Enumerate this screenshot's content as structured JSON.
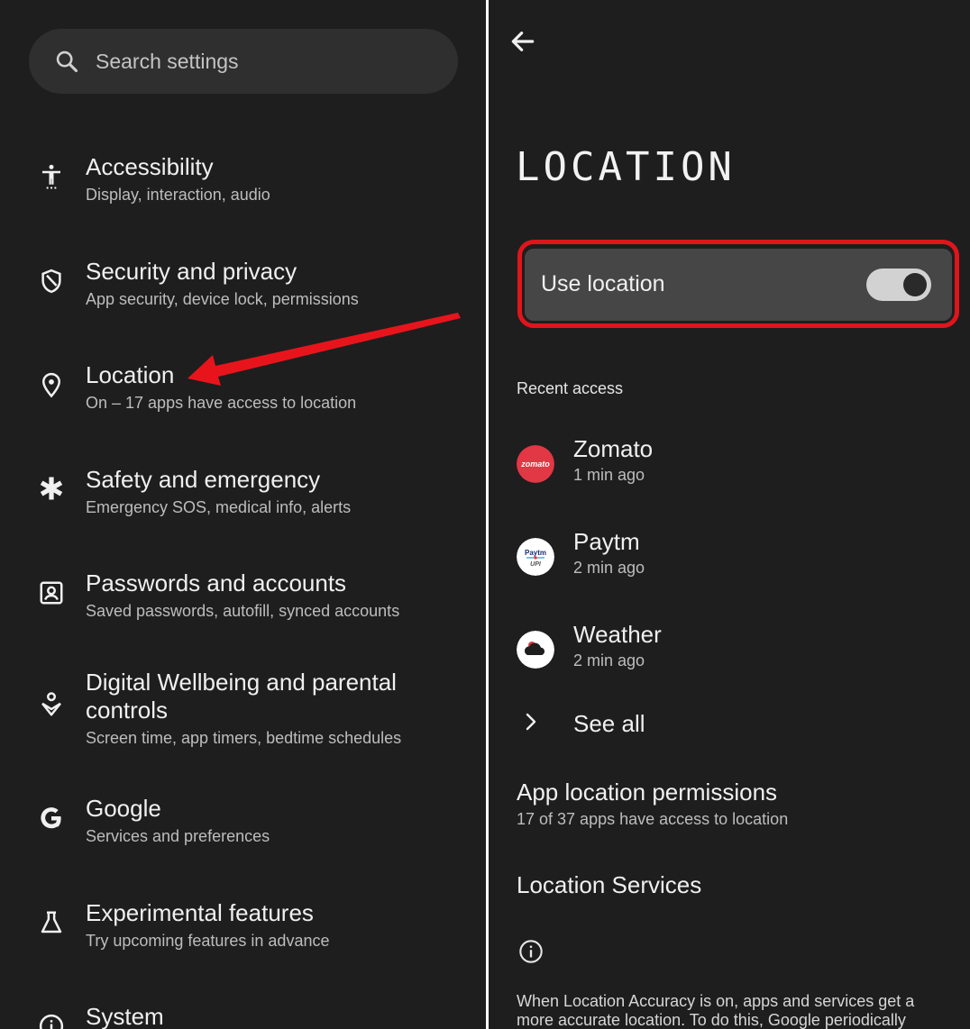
{
  "search": {
    "placeholder": "Search settings"
  },
  "settings": [
    {
      "title": "Accessibility",
      "subtitle": "Display, interaction, audio",
      "icon": "accessibility-icon"
    },
    {
      "title": "Security and privacy",
      "subtitle": "App security, device lock, permissions",
      "icon": "shield-icon"
    },
    {
      "title": "Location",
      "subtitle": "On – 17 apps have access to location",
      "icon": "location-pin-icon"
    },
    {
      "title": "Safety and emergency",
      "subtitle": "Emergency SOS, medical info, alerts",
      "icon": "asterisk-icon"
    },
    {
      "title": "Passwords and accounts",
      "subtitle": "Saved passwords, autofill, synced accounts",
      "icon": "account-box-icon"
    },
    {
      "title_line1": "Digital Wellbeing and parental",
      "title_line2": "controls",
      "subtitle": "Screen time, app timers, bedtime schedules",
      "icon": "wellbeing-icon"
    },
    {
      "title": "Google",
      "subtitle": "Services and preferences",
      "icon": "google-icon"
    },
    {
      "title": "Experimental features",
      "subtitle": "Try upcoming features in advance",
      "icon": "flask-icon"
    },
    {
      "title": "System",
      "icon": "info-icon"
    }
  ],
  "location_page": {
    "title": "LOCATION",
    "use_location": {
      "label": "Use location",
      "enabled": true
    },
    "recent_access_heading": "Recent access",
    "recent_apps": [
      {
        "name": "Zomato",
        "time": "1 min ago",
        "logo_text": "zomato",
        "color": "#e23744"
      },
      {
        "name": "Paytm",
        "time": "2 min ago",
        "logo_text": "Paytm UPI",
        "color": "#ffffff"
      },
      {
        "name": "Weather",
        "time": "2 min ago",
        "color": "#ffffff"
      }
    ],
    "see_all": "See all",
    "app_permissions": {
      "title": "App location permissions",
      "subtitle": "17 of 37 apps have access to location"
    },
    "services": "Location Services",
    "info_text": "When Location Accuracy is on, apps and services get a more accurate location. To do this, Google periodically"
  },
  "colors": {
    "background": "#1e1e1e",
    "highlight": "#e0151c",
    "annotation_arrow": "#e8141c"
  }
}
